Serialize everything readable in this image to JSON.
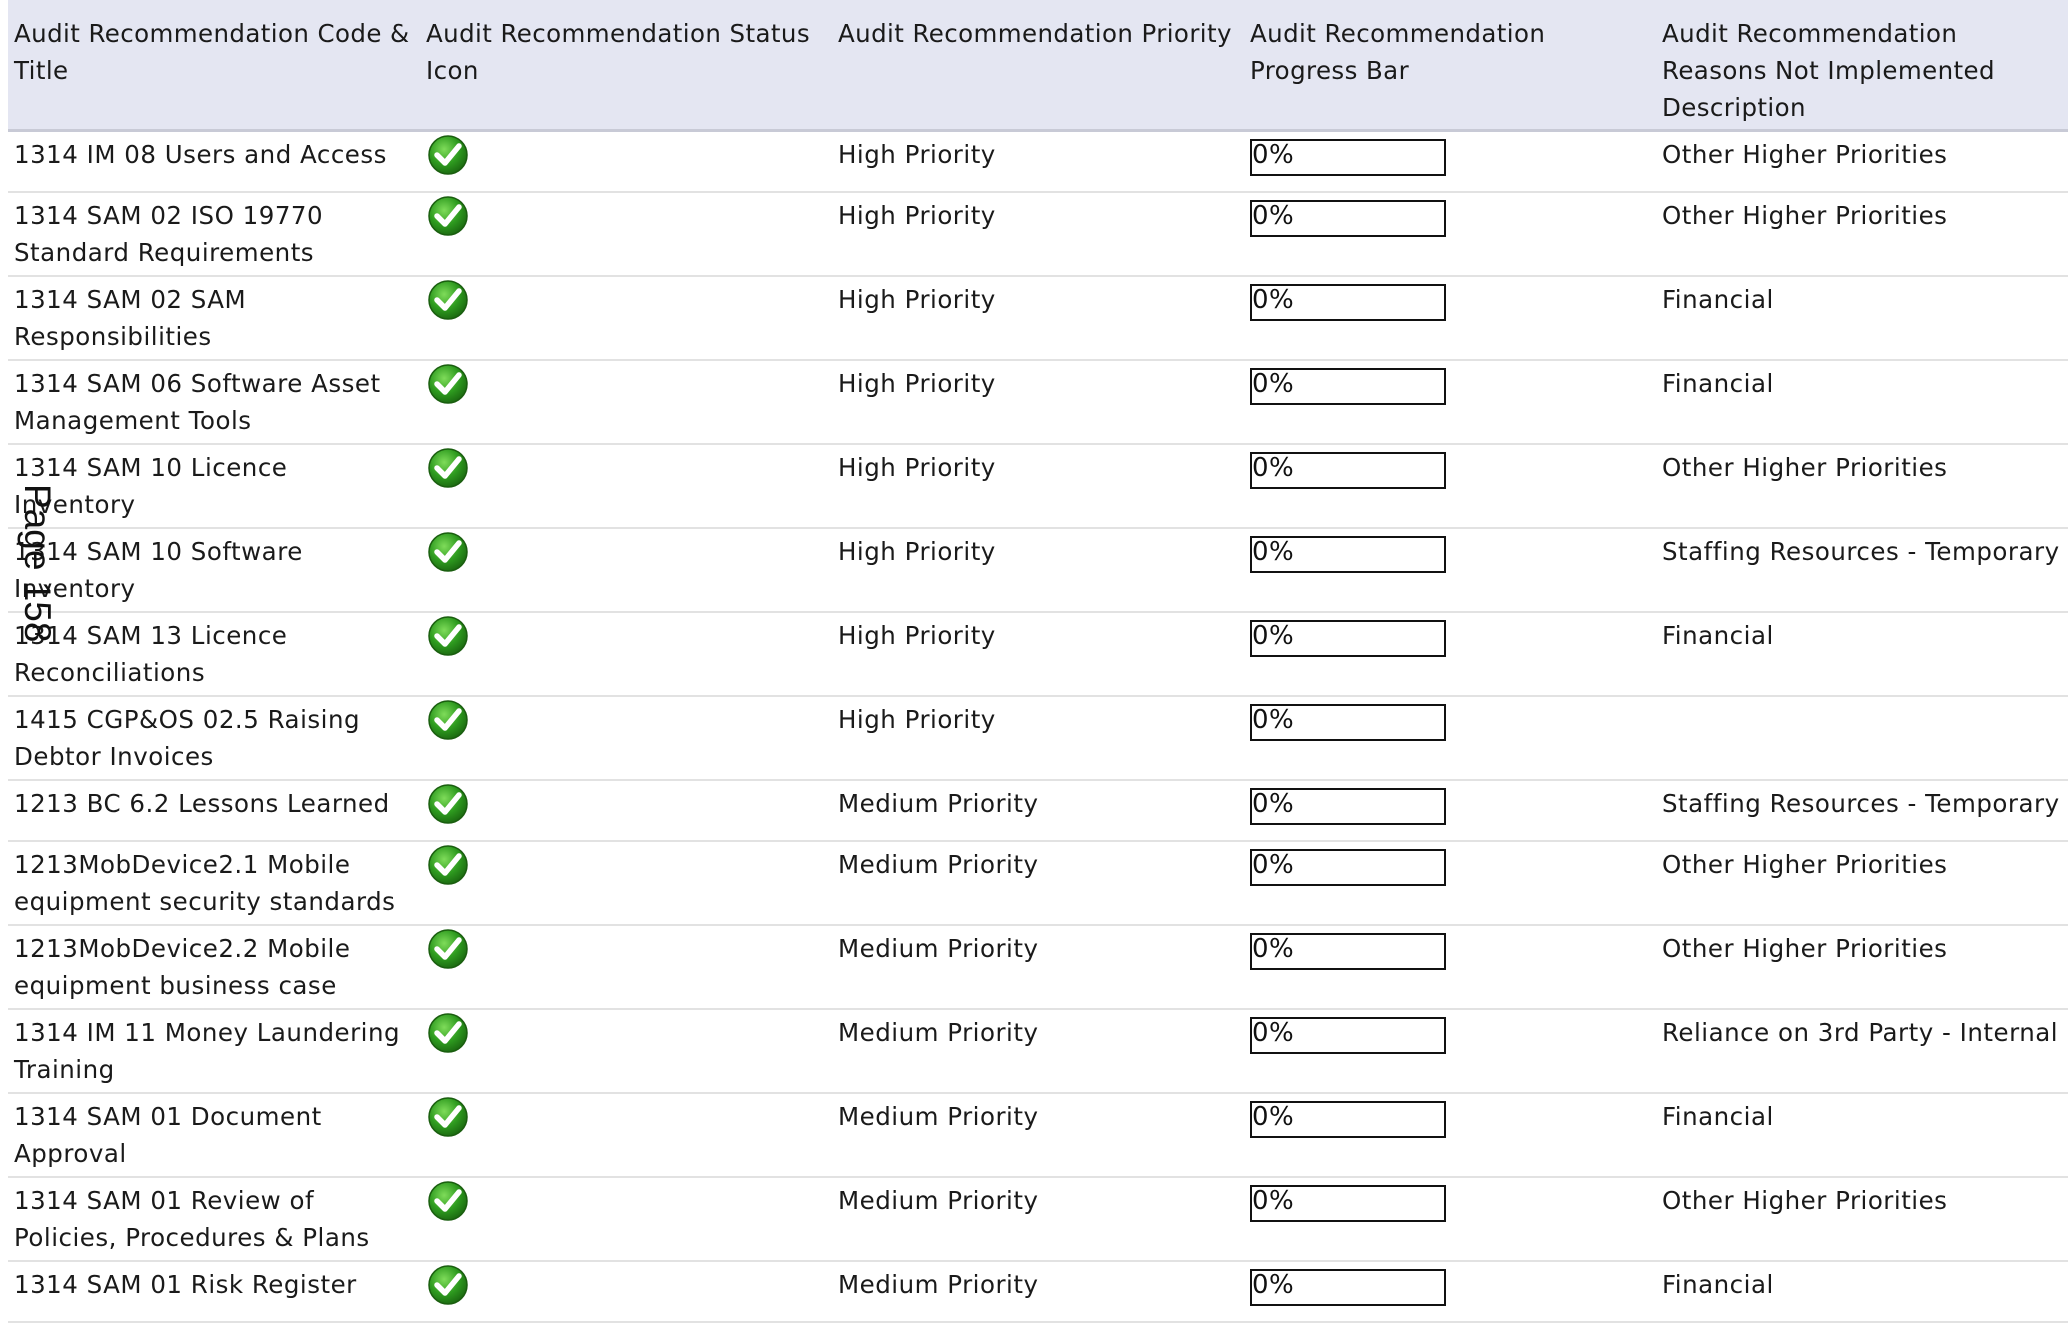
{
  "headers": [
    "Audit Recommendation Code & Title",
    "Audit Recommendation Status Icon",
    "Audit Recommendation Priority",
    "Audit Recommendation Progress Bar",
    "Audit Recommendation Reasons Not Implemented Description"
  ],
  "page_label": "Page 158",
  "colors": {
    "header_bg": "#e4e6f2",
    "status_icon": "#2e9b1f"
  },
  "rows": [
    {
      "title": "1314 IM 08 Users and Access",
      "status_icon": "green-check-icon",
      "priority": "High Priority",
      "progress": 0,
      "progress_label": "0%",
      "reason": "Other Higher Priorities"
    },
    {
      "title": "1314 SAM 02 ISO 19770 Standard Requirements",
      "status_icon": "green-check-icon",
      "priority": "High Priority",
      "progress": 0,
      "progress_label": "0%",
      "reason": "Other Higher Priorities"
    },
    {
      "title": "1314 SAM 02 SAM Responsibilities",
      "status_icon": "green-check-icon",
      "priority": "High Priority",
      "progress": 0,
      "progress_label": "0%",
      "reason": "Financial"
    },
    {
      "title": "1314 SAM 06 Software Asset Management Tools",
      "status_icon": "green-check-icon",
      "priority": "High Priority",
      "progress": 0,
      "progress_label": "0%",
      "reason": "Financial"
    },
    {
      "title": "1314 SAM 10 Licence Inventory",
      "status_icon": "green-check-icon",
      "priority": "High Priority",
      "progress": 0,
      "progress_label": "0%",
      "reason": "Other Higher Priorities"
    },
    {
      "title": "1314 SAM 10 Software Inventory",
      "status_icon": "green-check-icon",
      "priority": "High Priority",
      "progress": 0,
      "progress_label": "0%",
      "reason": "Staffing Resources - Temporary"
    },
    {
      "title": "1314 SAM 13 Licence Reconciliations",
      "status_icon": "green-check-icon",
      "priority": "High Priority",
      "progress": 0,
      "progress_label": "0%",
      "reason": "Financial"
    },
    {
      "title": "1415 CGP&OS 02.5 Raising Debtor Invoices",
      "status_icon": "green-check-icon",
      "priority": "High Priority",
      "progress": 0,
      "progress_label": "0%",
      "reason": ""
    },
    {
      "title": "1213 BC 6.2 Lessons Learned",
      "status_icon": "green-check-icon",
      "priority": "Medium Priority",
      "progress": 0,
      "progress_label": "0%",
      "reason": "Staffing Resources - Temporary"
    },
    {
      "title": "1213MobDevice2.1 Mobile equipment security standards",
      "status_icon": "green-check-icon",
      "priority": "Medium Priority",
      "progress": 0,
      "progress_label": "0%",
      "reason": "Other Higher Priorities"
    },
    {
      "title": "1213MobDevice2.2 Mobile equipment business case",
      "status_icon": "green-check-icon",
      "priority": "Medium Priority",
      "progress": 0,
      "progress_label": "0%",
      "reason": "Other Higher Priorities"
    },
    {
      "title": "1314 IM 11 Money Laundering Training",
      "status_icon": "green-check-icon",
      "priority": "Medium Priority",
      "progress": 0,
      "progress_label": "0%",
      "reason": "Reliance on 3rd Party - Internal"
    },
    {
      "title": "1314 SAM 01 Document Approval",
      "status_icon": "green-check-icon",
      "priority": "Medium Priority",
      "progress": 0,
      "progress_label": "0%",
      "reason": "Financial"
    },
    {
      "title": "1314 SAM 01 Review of Policies, Procedures & Plans",
      "status_icon": "green-check-icon",
      "priority": "Medium Priority",
      "progress": 0,
      "progress_label": "0%",
      "reason": "Other Higher Priorities"
    },
    {
      "title": "1314 SAM 01 Risk Register",
      "status_icon": "green-check-icon",
      "priority": "Medium Priority",
      "progress": 0,
      "progress_label": "0%",
      "reason": "Financial"
    }
  ]
}
